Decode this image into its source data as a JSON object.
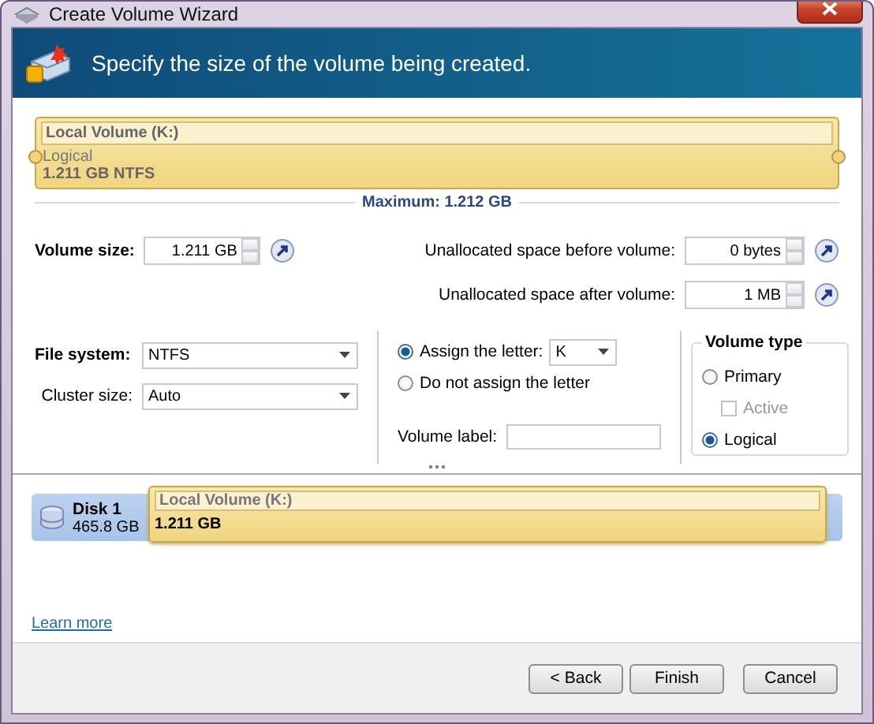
{
  "window": {
    "title": "Create Volume Wizard"
  },
  "header": {
    "text": "Specify the size of the volume being created."
  },
  "volume_bar": {
    "name": "Local Volume (K:)",
    "type": "Logical",
    "size": "1.211 GB NTFS",
    "maximum": "Maximum: 1.212 GB"
  },
  "size_fields": [
    {
      "label": "Volume size:",
      "value": "1.211 GB"
    },
    {
      "label": "Unallocated space before volume:",
      "value": "0 bytes"
    },
    {
      "label": "Unallocated space after volume:",
      "value": "1 MB"
    }
  ],
  "file_system": {
    "label": "File system:",
    "value": "NTFS"
  },
  "cluster_size": {
    "label": "Cluster size:",
    "value": "Auto"
  },
  "letter_options": [
    {
      "label": "Assign the letter:",
      "selected": true
    },
    {
      "label": "Do not assign the letter",
      "selected": false
    }
  ],
  "letter": "K",
  "volume_label": {
    "label": "Volume label:"
  },
  "volume_type": {
    "title": "Volume type",
    "options": [
      {
        "label": "Primary",
        "selected": false
      },
      {
        "label": "Logical",
        "selected": true
      }
    ],
    "active": {
      "label": "Active",
      "checked": false,
      "disabled": true
    }
  },
  "disk_map": {
    "disk": "Disk 1",
    "capacity": "465.8 GB",
    "partition_name": "Local Volume (K:)",
    "partition_size": "1.211 GB"
  },
  "learn_more": "Learn more",
  "buttons": [
    {
      "label": "< Back"
    },
    {
      "label": "Finish"
    },
    {
      "label": "Cancel"
    }
  ]
}
